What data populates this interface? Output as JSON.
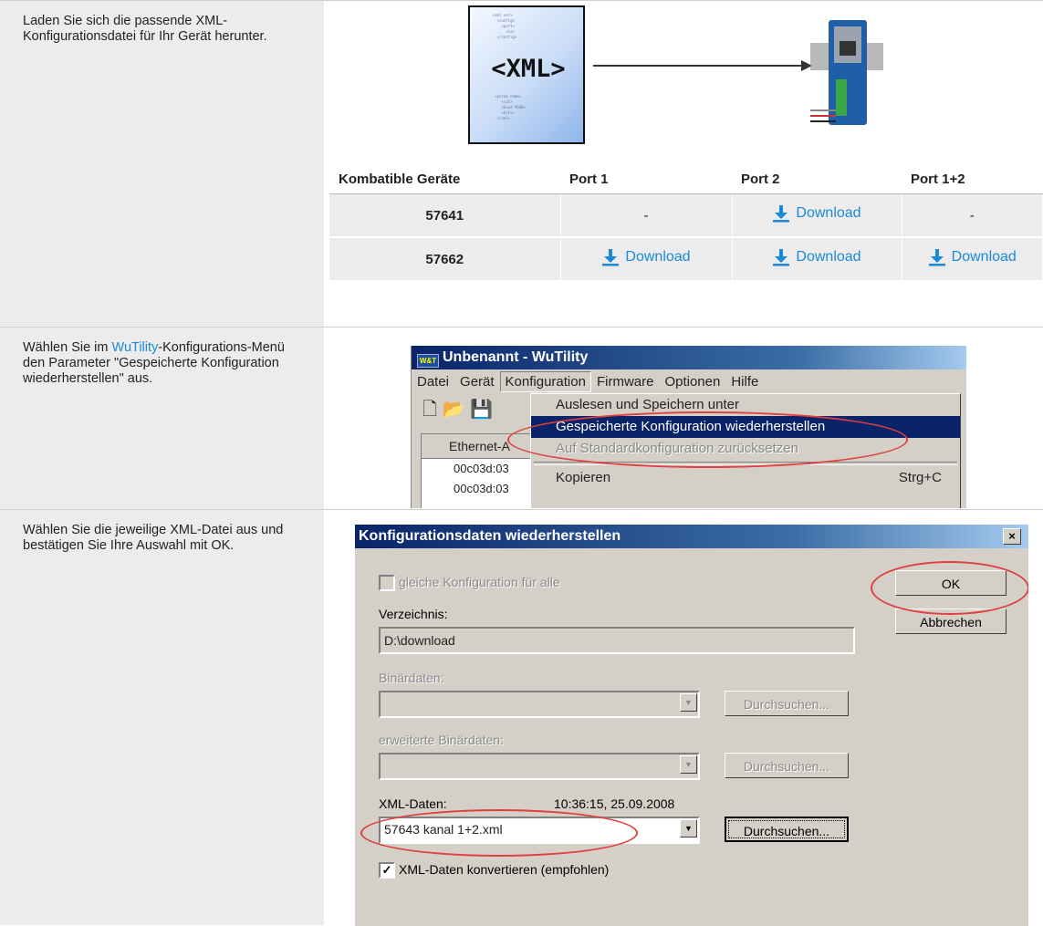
{
  "step1": {
    "text": "Laden Sie sich die passende XML-Konfigurationsdatei für Ihr Gerät herunter.",
    "xml_label": "<XML>",
    "table": {
      "headers": [
        "Kombatible Geräte",
        "Port 1",
        "Port 2",
        "Port 1+2"
      ],
      "rows": [
        {
          "device": "57641",
          "port1": "-",
          "port2": "Download",
          "port12": "-"
        },
        {
          "device": "57662",
          "port1": "Download",
          "port2": "Download",
          "port12": "Download"
        }
      ]
    }
  },
  "step2": {
    "text_before": "Wählen Sie im ",
    "link": "WuTility",
    "text_after": "-Konfigurations-Menü den Parameter \"Gespeicherte Konfiguration wiederherstellen\" aus.",
    "window_title": "Unbenannt - WuTility",
    "app_icon_text": "W&T",
    "menu": [
      "Datei",
      "Gerät",
      "Konfiguration",
      "Firmware",
      "Optionen",
      "Hilfe"
    ],
    "dropdown": [
      "Auslesen und Speichern unter",
      "Gespeicherte Konfiguration wiederherstellen",
      "Auf Standardkonfiguration zurücksetzen",
      "Kopieren"
    ],
    "shortcut": "Strg+C",
    "grid_header": "Ethernet-A",
    "grid_rows": [
      "00c03d:03",
      "00c03d:03"
    ]
  },
  "step3": {
    "text": "Wählen Sie die jeweilige XML-Datei aus und bestätigen Sie Ihre Auswahl mit OK.",
    "dialog_title": "Konfigurationsdaten wiederherstellen",
    "close": "×",
    "same_config": "gleiche Konfiguration für alle",
    "verzeichnis_label": "Verzeichnis:",
    "verzeichnis_value": "D:\\download",
    "binaer_label": "Binärdaten:",
    "ext_binaer_label": "erweiterte Binärdaten:",
    "xml_label": "XML-Daten:",
    "xml_timestamp": "10:36:15, 25.09.2008",
    "xml_value": "57643 kanal 1+2.xml",
    "browse": "Durchsuchen...",
    "convert": "XML-Daten konvertieren (empfohlen)",
    "ok": "OK",
    "cancel": "Abbrechen"
  },
  "colors": {
    "link": "#1a8ad8",
    "highlight_ellipse": "#e04040",
    "titlebar": "#0a246a"
  }
}
